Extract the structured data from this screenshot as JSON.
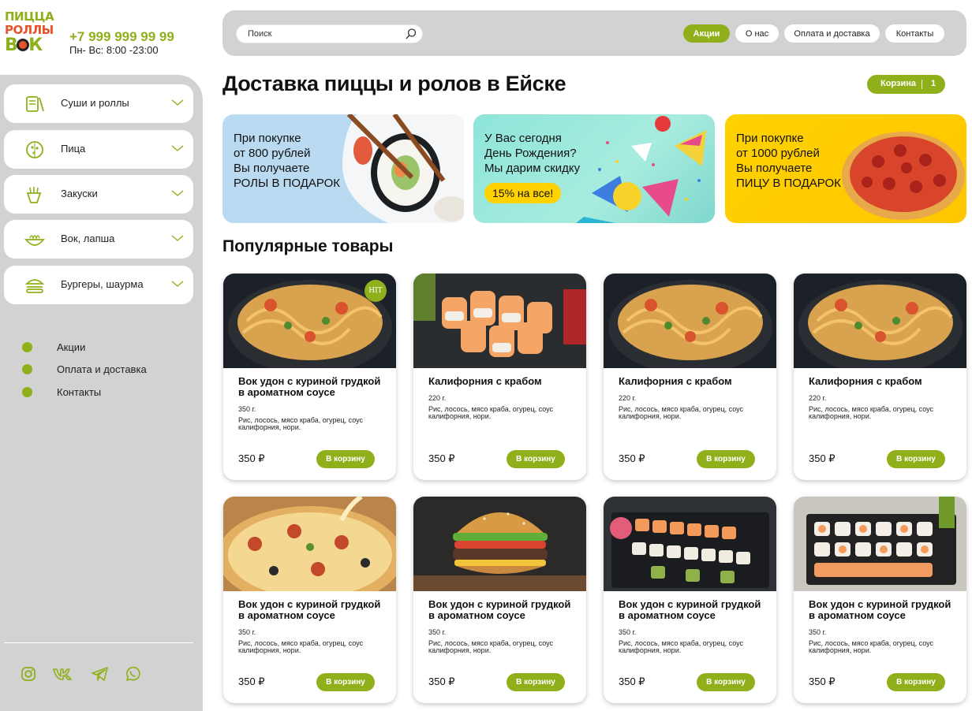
{
  "logo": {
    "line1": "ПИЦЦА",
    "line2": "РОЛЛЫ",
    "line3a": "В",
    "line3b": "К"
  },
  "contacts": {
    "phone": "+7 999 999 99 99",
    "hours": "Пн- Вс: 8:00 -23:00"
  },
  "categories": [
    {
      "label": "Суши и роллы",
      "icon": "sushi-icon"
    },
    {
      "label": "Пица",
      "icon": "pizza-icon"
    },
    {
      "label": "Закуски",
      "icon": "snacks-icon"
    },
    {
      "label": "Вок, лапша",
      "icon": "wok-icon"
    },
    {
      "label": "Бургеры, шаурма",
      "icon": "burger-icon"
    }
  ],
  "side_menu": [
    {
      "label": "Акции"
    },
    {
      "label": "Оплата и доставка"
    },
    {
      "label": "Контакты"
    }
  ],
  "social": [
    "instagram-icon",
    "vk-icon",
    "telegram-icon",
    "whatsapp-icon"
  ],
  "search": {
    "placeholder": "Поиск"
  },
  "nav": [
    {
      "label": "Акции",
      "active": true
    },
    {
      "label": "О нас",
      "active": false
    },
    {
      "label": "Оплата и доставка",
      "active": false
    },
    {
      "label": "Контакты",
      "active": false
    }
  ],
  "page_title": "Доставка пиццы и ролов в Ейске",
  "cart": {
    "label": "Корзина",
    "count": "1"
  },
  "banners": [
    {
      "lines": [
        "При покупке",
        "от 800 рублей",
        "Вы получаете",
        "РОЛЫ В ПОДАРОК"
      ]
    },
    {
      "lines": [
        "У Вас сегодня",
        "День Рождения?",
        "Мы дарим скидку"
      ],
      "badge": "15% на все!"
    },
    {
      "lines": [
        "При покупке",
        "от 1000 рублей",
        "Вы получаете",
        "ПИЦУ В ПОДАРОК"
      ]
    }
  ],
  "popular_title": "Популярные товары",
  "products": [
    {
      "name": "Вок удон с куриной грудкой в ароматном соусе",
      "weight": "350 г.",
      "desc": "Рис, лосось, мясо краба, огурец, соус калифорния, нори.",
      "price": "350 ₽",
      "button": "В корзину",
      "badge": "HIT",
      "image": "noodles"
    },
    {
      "name": "Калифорния с крабом",
      "weight": "220 г.",
      "desc": "Рис, лосось, мясо краба, огурец, соус калифорния, нори.",
      "price": "350 ₽",
      "button": "В корзину",
      "image": "rolls"
    },
    {
      "name": "Калифорния с крабом",
      "weight": "220 г.",
      "desc": "Рис, лосось, мясо краба, огурец, соус калифорния, нори.",
      "price": "350 ₽",
      "button": "В корзину",
      "image": "noodles"
    },
    {
      "name": "Калифорния с крабом",
      "weight": "220 г.",
      "desc": "Рис, лосось, мясо краба, огурец, соус калифорния, нори.",
      "price": "350 ₽",
      "button": "В корзину",
      "image": "noodles"
    },
    {
      "name": "Вок удон с куриной грудкой в ароматном соусе",
      "weight": "350 г.",
      "desc": "Рис, лосось, мясо краба, огурец, соус калифорния, нори.",
      "price": "350 ₽",
      "button": "В корзину",
      "image": "pizza"
    },
    {
      "name": "Вок удон с куриной грудкой в ароматном соусе",
      "weight": "350 г.",
      "desc": "Рис, лосось, мясо краба, огурец, соус калифорния, нори.",
      "price": "350 ₽",
      "button": "В корзину",
      "image": "burger"
    },
    {
      "name": "Вок удон с куриной грудкой в ароматном соусе",
      "weight": "350 г.",
      "desc": "Рис, лосось, мясо краба, огурец, соус калифорния, нори.",
      "price": "350 ₽",
      "button": "В корзину",
      "image": "sushi-set"
    },
    {
      "name": "Вок удон с куриной грудкой в ароматном соусе",
      "weight": "350 г.",
      "desc": "Рис, лосось, мясо краба, огурец, соус калифорния, нори.",
      "price": "350 ₽",
      "button": "В корзину",
      "image": "sushi-set"
    }
  ],
  "colors": {
    "accent": "#8fb01a",
    "sidebar": "#d2d2d2",
    "promo_yellow": "#ffd200"
  }
}
